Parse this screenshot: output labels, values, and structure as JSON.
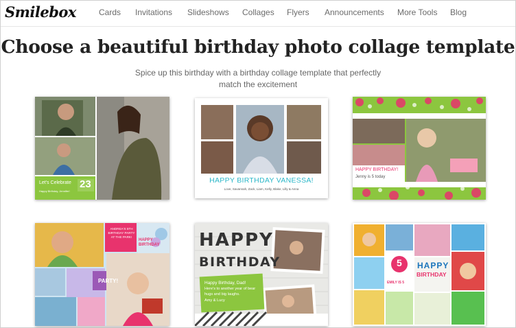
{
  "brand": {
    "logo_text": "Smilebox"
  },
  "nav": {
    "items": [
      {
        "label": "Cards"
      },
      {
        "label": "Invitations"
      },
      {
        "label": "Slideshows"
      },
      {
        "label": "Collages"
      },
      {
        "label": "Flyers"
      },
      {
        "label": "Announcements"
      },
      {
        "label": "More Tools"
      },
      {
        "label": "Blog"
      }
    ]
  },
  "hero": {
    "title": "Choose a beautiful birthday photo collage template",
    "subtitle_line1": "Spice up this birthday with a birthday collage template that perfectly",
    "subtitle_line2": "match the excitement"
  },
  "templates": [
    {
      "name": "Let's Celebrate",
      "line1": "Let's Celebrate",
      "number": "23",
      "line2": "Happy Birthday, Jennifer!",
      "accent": "#8cc63f"
    },
    {
      "name": "Happy Birthday Vanessa",
      "line1": "HAPPY BIRTHDAY VANESSA!",
      "line2": "Love, Savannah, Zack, Liam, Kelly, Blake, Lilly & Anna",
      "accent": "#2bb7c9"
    },
    {
      "name": "Jenny is 5",
      "line1": "HAPPY BIRTHDAY!",
      "line2": "Jenny is 5 today",
      "accent": "#e8336d"
    },
    {
      "name": "Andrea's 5th",
      "line1": "ANDREA'S 5TH BIRTHDAY PARTY AT THE PARK!",
      "line2": "HAPPY BIRTHDAY",
      "line3": "PARTY!",
      "accent": "#e8336d"
    },
    {
      "name": "Happy Birthday Dad",
      "line1": "HAPPY",
      "line2": "BIRTHDAY",
      "line3": "Happy Birthday, Dad!",
      "line4": "Here's to another year of bear",
      "line5": "hugs and big laughs.",
      "line6": "Amy & Lucy",
      "accent": "#8cc63f"
    },
    {
      "name": "Emily is 5",
      "line1": "HAPPY",
      "line2": "BIRTHDAY",
      "number": "5",
      "line3": "EMILY IS 5",
      "accent": "#e8336d"
    }
  ]
}
